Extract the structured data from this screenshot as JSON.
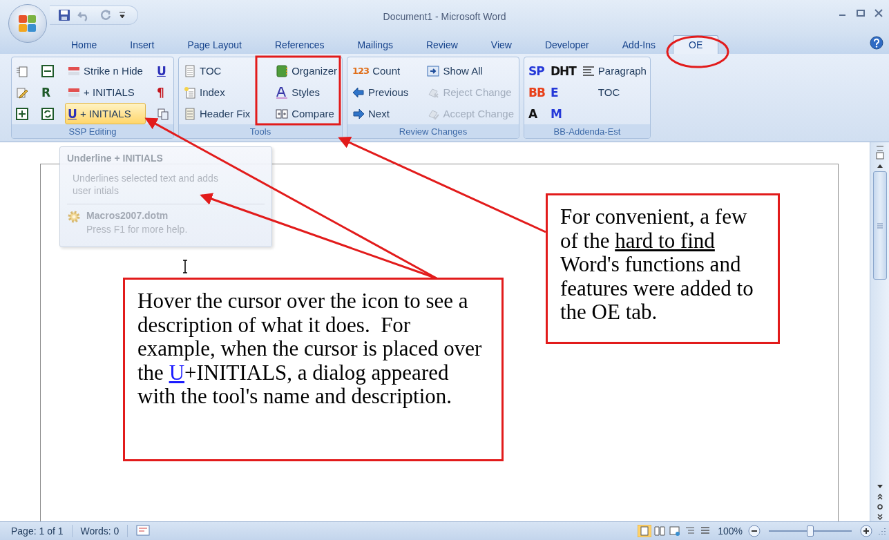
{
  "window": {
    "title": "Document1 - Microsoft Word"
  },
  "tabs": [
    {
      "label": "Home",
      "selected": false
    },
    {
      "label": "Insert",
      "selected": false
    },
    {
      "label": "Page Layout",
      "selected": false
    },
    {
      "label": "References",
      "selected": false
    },
    {
      "label": "Mailings",
      "selected": false
    },
    {
      "label": "Review",
      "selected": false
    },
    {
      "label": "View",
      "selected": false
    },
    {
      "label": "Developer",
      "selected": false
    },
    {
      "label": "Add-Ins",
      "selected": false
    },
    {
      "label": "OE",
      "selected": true
    }
  ],
  "ribbon_groups": [
    {
      "name": "SSP Editing",
      "columns": [
        [
          {
            "kind": "icon"
          },
          {
            "kind": "icon"
          },
          {
            "kind": "icon"
          }
        ],
        [
          {
            "kind": "icon"
          },
          {
            "kind": "glyph",
            "glyph": "R",
            "color": "#1f5a2a"
          },
          {
            "kind": "icon"
          }
        ],
        [
          {
            "kind": "button",
            "label": "Strike n Hide",
            "disabled": false,
            "highlighted": false
          },
          {
            "kind": "button",
            "label": "+ INITIALS",
            "disabled": false,
            "highlighted": false
          },
          {
            "kind": "button",
            "glyph": "U",
            "color": "#2b2fb8",
            "label": "+ INITIALS",
            "disabled": false,
            "highlighted": true
          }
        ],
        [
          {
            "kind": "glyph",
            "glyph": "U",
            "color": "#2b2fb8"
          },
          {
            "kind": "glyph",
            "glyph": "¶",
            "color": "#c4141c"
          },
          {
            "kind": "icon"
          }
        ]
      ]
    },
    {
      "name": "Tools",
      "columns": [
        [
          {
            "kind": "button",
            "label": "TOC",
            "disabled": false,
            "highlighted": false
          },
          {
            "kind": "button",
            "label": "Index",
            "disabled": false,
            "highlighted": false
          },
          {
            "kind": "button",
            "label": "Header Fix",
            "disabled": false,
            "highlighted": false
          }
        ],
        [
          {
            "kind": "button",
            "label": "Organizer",
            "disabled": false,
            "highlighted": false
          },
          {
            "kind": "button",
            "label": "Styles",
            "disabled": false,
            "highlighted": false
          },
          {
            "kind": "button",
            "label": "Compare",
            "disabled": false,
            "highlighted": false
          }
        ]
      ]
    },
    {
      "name": "Review Changes",
      "columns": [
        [
          {
            "kind": "button",
            "glyph": "123",
            "color": "#e0701c",
            "label": "Count",
            "disabled": false,
            "highlighted": false
          },
          {
            "kind": "button",
            "label": "Previous",
            "disabled": false,
            "highlighted": false
          },
          {
            "kind": "button",
            "label": "Next",
            "disabled": false,
            "highlighted": false
          }
        ],
        [
          {
            "kind": "button",
            "label": "Show All",
            "disabled": false,
            "highlighted": false
          },
          {
            "kind": "button",
            "label": "Reject Change",
            "disabled": true,
            "highlighted": false
          },
          {
            "kind": "button",
            "label": "Accept Change",
            "disabled": true,
            "highlighted": false
          }
        ]
      ]
    },
    {
      "name": "BB-Addenda-Est",
      "columns": [
        [
          {
            "kind": "glyph",
            "glyph": "SP",
            "color": "#2438d8"
          },
          {
            "kind": "glyph",
            "glyph": "BB",
            "color": "#e8401a"
          },
          {
            "kind": "glyph",
            "glyph": "A",
            "color": "#111111"
          }
        ],
        [
          {
            "kind": "glyph",
            "glyph": "DHT",
            "color": "#111111"
          },
          {
            "kind": "glyph",
            "glyph": "E",
            "color": "#2438d8"
          },
          {
            "kind": "glyph",
            "glyph": "M",
            "color": "#2438d8"
          }
        ],
        [
          {
            "kind": "button",
            "label": "Paragraph",
            "disabled": false,
            "highlighted": false
          },
          {
            "kind": "button",
            "label": "TOC",
            "disabled": false,
            "highlighted": false
          }
        ]
      ]
    }
  ],
  "tooltip": {
    "title": "Underline + INITIALS",
    "description": "Underlines selected text and adds user intials",
    "source": "Macros2007.dotm",
    "help": "Press F1 for more help."
  },
  "callouts": [
    {
      "segments": [
        {
          "kind": "plain",
          "text": "Hover the cursor over the icon to see a description of what it does.  For example, when the cursor is placed over the "
        },
        {
          "kind": "link",
          "text": "U"
        },
        {
          "kind": "plain",
          "text": "+INITIALS, a dialog appeared with the tool's name and description."
        }
      ]
    },
    {
      "segments": [
        {
          "kind": "plain",
          "text": "For convenient, a few of the "
        },
        {
          "kind": "underline",
          "text": "hard to find"
        },
        {
          "kind": "plain",
          "text": " Word's functions and features were added to the OE tab."
        }
      ]
    }
  ],
  "status_bar": {
    "page": "Page: 1 of 1",
    "words": "Words: 0",
    "zoom": "100%",
    "zoom_level": {
      "level": 0.5
    }
  }
}
